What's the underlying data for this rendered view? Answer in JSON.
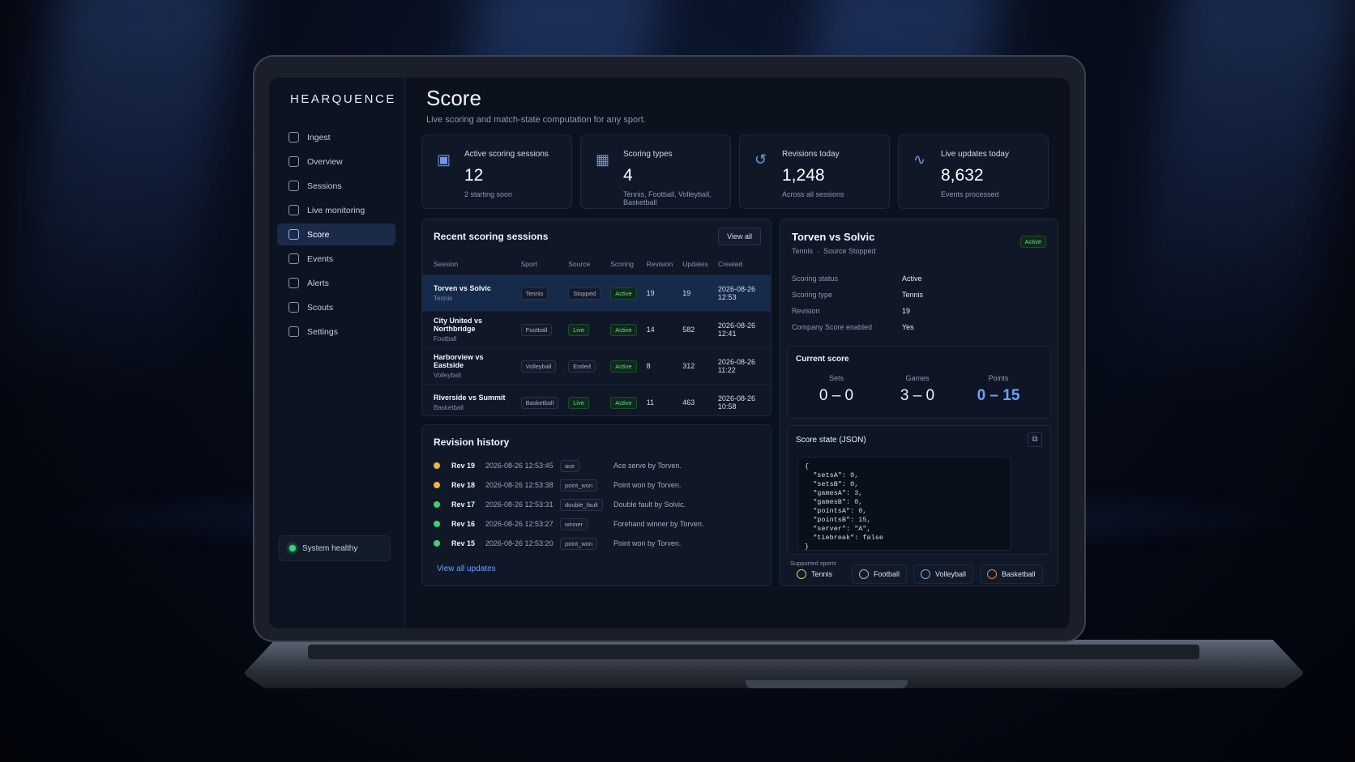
{
  "app": {
    "brand": "HEARQUENCE",
    "page_title": "Score",
    "page_subtitle": "Live scoring and match-state computation for any sport."
  },
  "sidebar": {
    "items": [
      {
        "label": "Ingest",
        "icon": "ingest-icon"
      },
      {
        "label": "Overview",
        "icon": "overview-icon"
      },
      {
        "label": "Sessions",
        "icon": "sessions-icon"
      },
      {
        "label": "Live monitoring",
        "icon": "live-monitoring-icon"
      },
      {
        "label": "Score",
        "icon": "score-icon",
        "active": true
      },
      {
        "label": "Events",
        "icon": "events-icon"
      },
      {
        "label": "Alerts",
        "icon": "bell-icon"
      },
      {
        "label": "Scouts",
        "icon": "scouts-icon"
      },
      {
        "label": "Settings",
        "icon": "gear-icon"
      }
    ],
    "health": "System healthy"
  },
  "stats": [
    {
      "label": "Active scoring sessions",
      "value": "12",
      "sub": "2 starting soon",
      "icon": "sessions-icon"
    },
    {
      "label": "Scoring types",
      "value": "4",
      "sub": "Tennis, Football, Volleyball, Basketball",
      "icon": "grid-icon"
    },
    {
      "label": "Revisions today",
      "value": "1,248",
      "sub": "Across all sessions",
      "icon": "history-icon"
    },
    {
      "label": "Live updates today",
      "value": "8,632",
      "sub": "Events processed",
      "icon": "pulse-icon"
    }
  ],
  "sessions": {
    "title": "Recent scoring sessions",
    "view_all": "View all",
    "columns": [
      "Session",
      "Sport",
      "Source",
      "Scoring",
      "Revision",
      "Updates",
      "Created"
    ],
    "rows": [
      {
        "name": "Torven vs Solvic",
        "sport_sub": "Tennis",
        "sport": "Tennis",
        "source": "Stopped",
        "scoring": "Active",
        "revision": "19",
        "updates": "19",
        "created": "2026-08-26 12:53",
        "selected": true
      },
      {
        "name": "City United vs Northbridge",
        "sport_sub": "Football",
        "sport": "Football",
        "source": "Live",
        "scoring": "Active",
        "revision": "14",
        "updates": "582",
        "created": "2026-08-26 12:41"
      },
      {
        "name": "Harborview vs Eastside",
        "sport_sub": "Volleyball",
        "sport": "Volleyball",
        "source": "Ended",
        "scoring": "Active",
        "revision": "8",
        "updates": "312",
        "created": "2026-08-26 11:22"
      },
      {
        "name": "Riverside vs Summit",
        "sport_sub": "Basketball",
        "sport": "Basketball",
        "source": "Live",
        "scoring": "Active",
        "revision": "11",
        "updates": "463",
        "created": "2026-08-26 10:58"
      }
    ]
  },
  "revisions": {
    "title": "Revision history",
    "view_all": "View all updates",
    "items": [
      {
        "rev": "Rev 19",
        "time": "2026-08-26 12:53:45",
        "tag": "ace",
        "desc": "Ace serve by Torven.",
        "color": "#f0b73a"
      },
      {
        "rev": "Rev 18",
        "time": "2026-08-26 12:53:38",
        "tag": "point_won",
        "desc": "Point won by Torven.",
        "color": "#f0b73a"
      },
      {
        "rev": "Rev 17",
        "time": "2026-08-26 12:53:31",
        "tag": "double_fault",
        "desc": "Double fault by Solvic.",
        "color": "#3ecf71"
      },
      {
        "rev": "Rev 16",
        "time": "2026-08-26 12:53:27",
        "tag": "winner",
        "desc": "Forehand winner by Torven.",
        "color": "#3ecf71"
      },
      {
        "rev": "Rev 15",
        "time": "2026-08-26 12:53:20",
        "tag": "point_won",
        "desc": "Point won by Torven.",
        "color": "#3ecf71"
      }
    ]
  },
  "detail": {
    "title": "Torven vs Solvic",
    "sub": "Tennis  ·  Source Stopped",
    "badge": "Active",
    "fields": [
      {
        "label": "Scoring status",
        "value": "Active"
      },
      {
        "label": "Scoring type",
        "value": "Tennis"
      },
      {
        "label": "Revision",
        "value": "19"
      },
      {
        "label": "Company Score enabled",
        "value": "Yes"
      }
    ],
    "current_score": {
      "title": "Current score",
      "sets_label": "Sets",
      "sets": "0 – 0",
      "games_label": "Games",
      "games": "3 – 0",
      "points_label": "Points",
      "points": "0 – 15"
    },
    "json_title": "Score state (JSON)",
    "json": "{\n  \"setsA\": 0,\n  \"setsB\": 0,\n  \"gamesA\": 3,\n  \"gamesB\": 0,\n  \"pointsA\": 0,\n  \"pointsB\": 15,\n  \"server\": \"A\",\n  \"tiebreak\": false\n}",
    "supported_label": "Supported sports",
    "sports": [
      "Tennis",
      "Football",
      "Volleyball",
      "Basketball"
    ]
  },
  "colors": {
    "accent": "#6ea0ff",
    "success": "#3ecf71",
    "warning": "#f0b73a",
    "background": "#0b111d"
  }
}
